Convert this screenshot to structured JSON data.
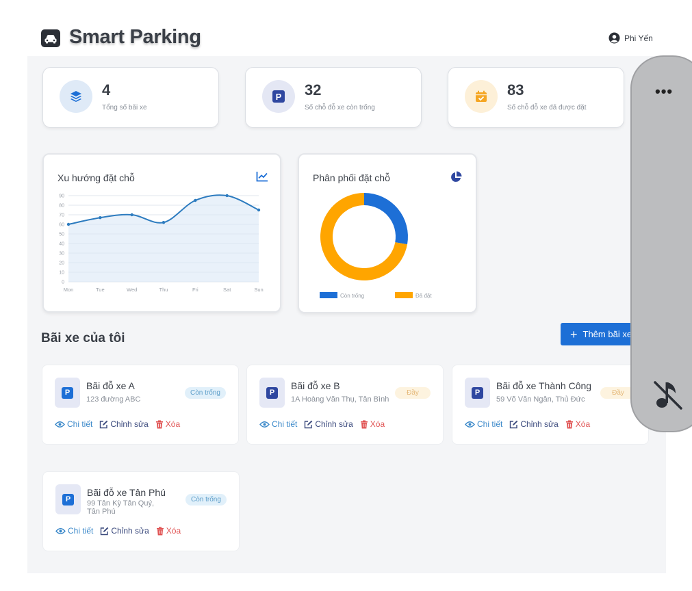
{
  "header": {
    "title": "Smart Parking",
    "user_name": "Phi Yến"
  },
  "stats": [
    {
      "value": "4",
      "label": "Tổng số bãi xe",
      "icon": "layers-icon",
      "color": "#1d6fd6"
    },
    {
      "value": "32",
      "label": "Số chỗ đỗ xe còn trống",
      "icon": "parking-icon",
      "color": "#2f47a0"
    },
    {
      "value": "83",
      "label": "Số chỗ đỗ xe đã được đặt",
      "icon": "calendar-check-icon",
      "color": "#f5a623"
    }
  ],
  "trend_chart": {
    "title": "Xu hướng đặt chỗ",
    "icon": "chart-line-icon"
  },
  "distribution_chart": {
    "title": "Phân phối đặt chỗ",
    "icon": "chart-pie-icon"
  },
  "chart_data": [
    {
      "type": "area",
      "title": "Xu hướng đặt chỗ",
      "categories": [
        "Mon",
        "Tue",
        "Wed",
        "Thu",
        "Fri",
        "Sat",
        "Sun"
      ],
      "values": [
        60,
        67,
        70,
        62,
        85,
        90,
        75
      ],
      "y_ticks": [
        "0",
        "10",
        "20",
        "30",
        "40",
        "50",
        "60",
        "70",
        "80",
        "90"
      ],
      "ylim": [
        0,
        90
      ],
      "grid": true,
      "color": "#2c7bbf"
    },
    {
      "type": "pie",
      "title": "Phân phối đặt chỗ",
      "labels": [
        "Còn trống",
        "Đã đặt"
      ],
      "values": [
        32,
        83
      ],
      "colors": [
        "#1d6fd6",
        "#ffa500"
      ],
      "donut": true,
      "legend": "bottom"
    }
  ],
  "section": {
    "title": "Bãi xe của tôi",
    "add_label": "Thêm bãi xe"
  },
  "lots": [
    {
      "name": "Bãi đỗ xe A",
      "address": "123 đường ABC",
      "status": "Còn trống",
      "status_type": "free"
    },
    {
      "name": "Bãi đỗ xe B",
      "address": "1A Hoàng Văn Thụ, Tân Bình",
      "status": "Đầy",
      "status_type": "full"
    },
    {
      "name": "Bãi đỗ xe Thành Công",
      "address": "59 Võ Văn Ngân, Thủ Đức",
      "status": "Đầy",
      "status_type": "full"
    },
    {
      "name": "Bãi đỗ xe Tân Phú",
      "address_line1": "99 Tân Kỳ Tân Quý,",
      "address_line2": "Tân Phú",
      "status": "Còn trống",
      "status_type": "free"
    }
  ],
  "lot_actions": {
    "detail": "Chi tiết",
    "edit": "Chỉnh sửa",
    "delete": "Xóa"
  },
  "overlay": {
    "menu_icon": "more-dots-icon",
    "music_icon": "music-off-icon"
  }
}
